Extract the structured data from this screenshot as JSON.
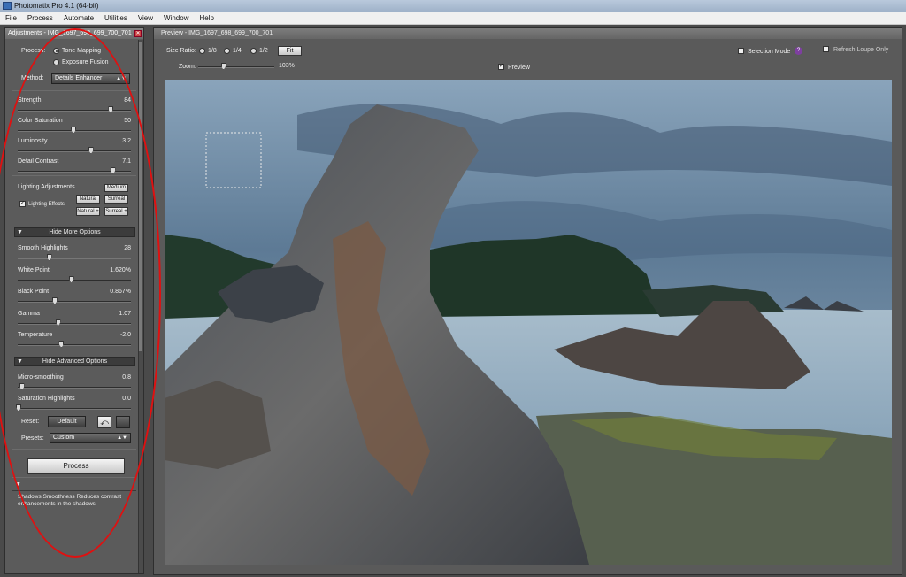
{
  "window": {
    "title": "Photomatix Pro 4.1 (64-bit)"
  },
  "menu": [
    "File",
    "Process",
    "Automate",
    "Utilities",
    "View",
    "Window",
    "Help"
  ],
  "adjustments": {
    "header": "Adjustments - IMG_1697_698_699_700_701",
    "close_glyph": "✕",
    "process_label": "Process:",
    "process_options": [
      "Tone Mapping",
      "Exposure Fusion"
    ],
    "method_label": "Method:",
    "method_value": "Details Enhancer",
    "sliders_main": [
      {
        "label": "Strength",
        "value": "84",
        "level": 0.84
      },
      {
        "label": "Color Saturation",
        "value": "50",
        "level": 0.5
      },
      {
        "label": "Luminosity",
        "value": "3.2",
        "level": 0.66
      },
      {
        "label": "Detail Contrast",
        "value": "7.1",
        "level": 0.86
      }
    ],
    "lighting_label": "Lighting Adjustments",
    "lighting_effects_label": "Lighting Effects",
    "lighting_buttons": [
      "Medium",
      "Natural",
      "Surreal",
      "Natural +",
      "Surreal +"
    ],
    "more_options_label": "Hide More Options",
    "sliders_more": [
      {
        "label": "Smooth Highlights",
        "value": "28",
        "level": 0.28
      },
      {
        "label": "White Point",
        "value": "1.620%",
        "level": 0.48
      },
      {
        "label": "Black Point",
        "value": "0.867%",
        "level": 0.33
      },
      {
        "label": "Gamma",
        "value": "1.07",
        "level": 0.36
      },
      {
        "label": "Temperature",
        "value": "-2.0",
        "level": 0.39
      }
    ],
    "advanced_label": "Hide Advanced Options",
    "sliders_adv": [
      {
        "label": "Micro-smoothing",
        "value": "0.8",
        "level": 0.03
      },
      {
        "label": "Saturation Highlights",
        "value": "0.0",
        "level": 0.0
      }
    ],
    "reset_label": "Reset:",
    "default_button": "Default",
    "presets_label": "Presets:",
    "presets_value": "Custom",
    "process_button": "Process",
    "help_text": "Shadows Smoothness Reduces contrast enhancements in the shadows"
  },
  "preview": {
    "header": "Preview - IMG_1697_698_699_700_701",
    "size_ratio_label": "Size Ratio:",
    "ratios": [
      "1/8",
      "1/4",
      "1/2"
    ],
    "fit_button": "Fit",
    "zoom_label": "Zoom:",
    "zoom_value": "103%",
    "zoom_level": 0.32,
    "preview_checkbox": "Preview",
    "selection_mode": "Selection Mode",
    "selection_help": "?",
    "refresh_loupe": "Refresh Loupe Only"
  },
  "colors": {
    "annotation": "#e01010",
    "panel_bg": "#5b5b5b",
    "sky": "#5d7a95",
    "water": "#7d9cb4"
  }
}
